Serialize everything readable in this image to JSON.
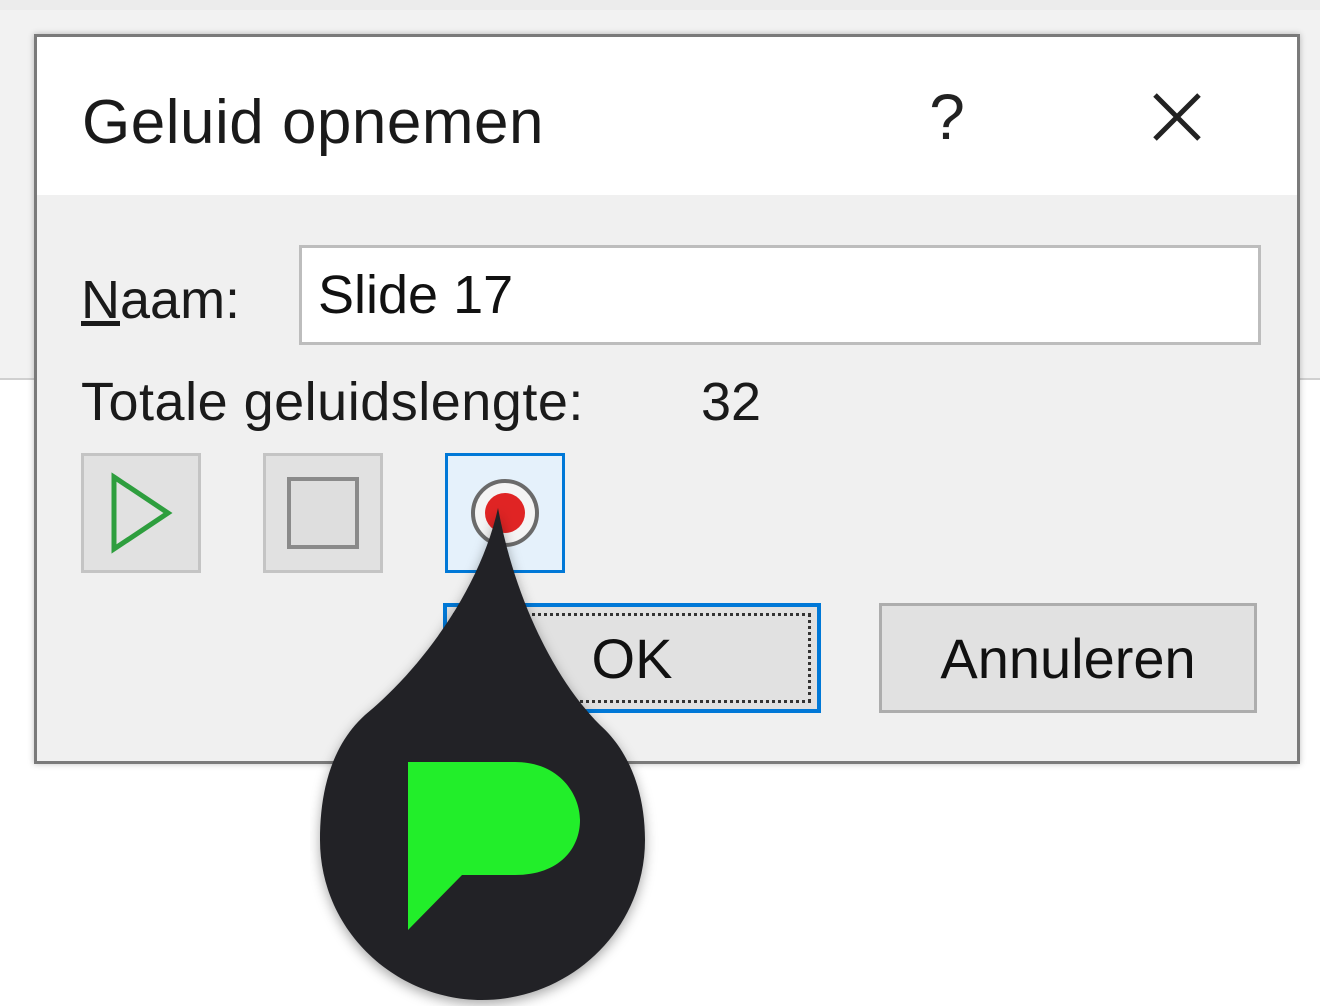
{
  "dialog": {
    "title": "Geluid opnemen",
    "help_glyph": "?",
    "close_icon": "close-icon"
  },
  "name": {
    "label_first": "N",
    "label_rest": "aam:",
    "value": "Slide 17"
  },
  "length": {
    "label": "Totale geluidslengte:",
    "value": "32"
  },
  "media_controls": [
    {
      "name": "play-icon",
      "color": "#2e9e3e"
    },
    {
      "name": "stop-icon",
      "color": "#8a8a8a"
    },
    {
      "name": "record-icon",
      "color": "#e02424"
    }
  ],
  "buttons": {
    "ok": "OK",
    "cancel": "Annuleren"
  },
  "overlay": {
    "icon": "speech-bubble-icon",
    "pin_color": "#222326",
    "logo_color": "#22ee2a"
  }
}
